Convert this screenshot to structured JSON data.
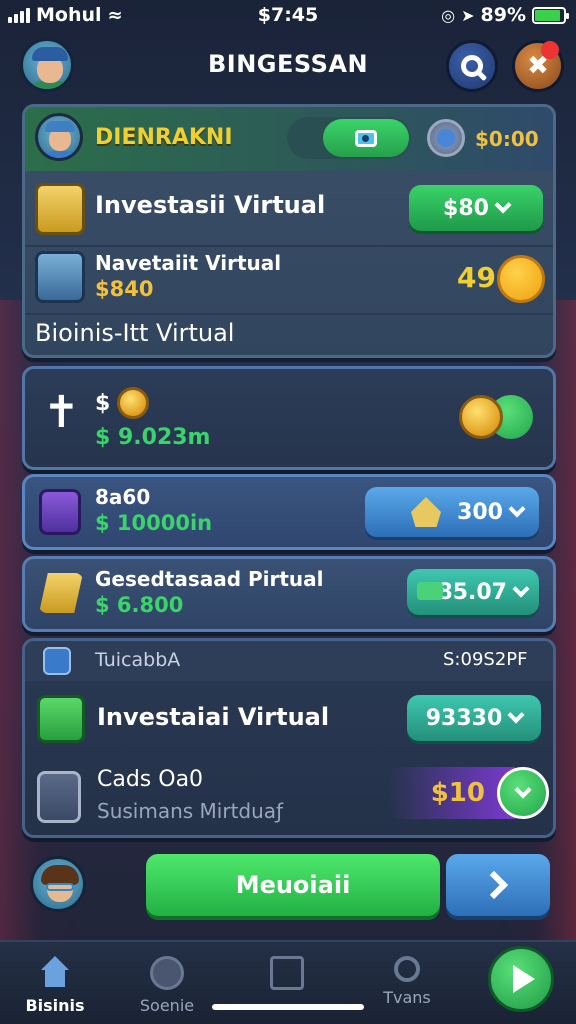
{
  "status_bar": {
    "carrier": "Mohul",
    "time": "$7:45",
    "battery": "89%"
  },
  "header": {
    "title": "BINGESSAN"
  },
  "top_panel": {
    "heading": "DIENRAKNI",
    "heading_value": "$0:00",
    "items": [
      {
        "label": "Investasii Virtual",
        "button": "$80"
      },
      {
        "label": "Navetaiit Virtual",
        "sub_value": "$840",
        "badge_value": "49"
      }
    ],
    "footer_label": "Bioinis-Itt Virtual"
  },
  "mid_panel": {
    "label": "$",
    "value": "$ 9.023m"
  },
  "row2": {
    "label": "8a60",
    "value": "$ 10000in",
    "button": "300"
  },
  "row3": {
    "label": "Gesedtasaad Pirtual",
    "value": "$ 6.800",
    "button": "85.07"
  },
  "bottom_panel": {
    "tab_label": "TuicabbA",
    "tab_value": "S:09S2PF",
    "items": [
      {
        "label": "Investaiai Virtual",
        "button": "93330"
      },
      {
        "label": "Cads Oa0",
        "sub_label": "Susimans Mirtduaƒ",
        "value": "$10"
      }
    ]
  },
  "cta": {
    "label": "Meuoiaii"
  },
  "tabbar": {
    "items": [
      {
        "label": "Bisinis",
        "icon": "home-icon",
        "active": true
      },
      {
        "label": "Soenie",
        "icon": "chat-icon",
        "active": false
      },
      {
        "label": "",
        "icon": "shop-icon",
        "active": false
      },
      {
        "label": "Tvans",
        "icon": "search-icon",
        "active": false
      }
    ]
  },
  "colors": {
    "accent_green": "#22b044",
    "accent_blue": "#2d6fb8",
    "gold": "#f0c040",
    "panel_bg": "#32455e"
  }
}
